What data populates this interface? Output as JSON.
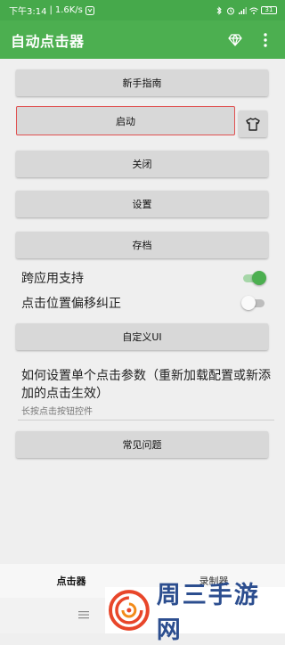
{
  "status_bar": {
    "time": "下午3:14",
    "speed": "1.6K/s",
    "battery": "31"
  },
  "app_bar": {
    "title": "自动点击器",
    "icons": [
      "diamond-icon",
      "more-vert-icon"
    ]
  },
  "buttons": {
    "guide": "新手指南",
    "start": "启动",
    "close": "关闭",
    "settings": "设置",
    "archive": "存档",
    "custom_ui": "自定义UI",
    "faq": "常见问题"
  },
  "toggles": [
    {
      "label": "跨应用支持",
      "on": true
    },
    {
      "label": "点击位置偏移纠正",
      "on": false
    }
  ],
  "info": {
    "title": "如何设置单个点击参数（重新加载配置或新添加的点击生效）",
    "subtitle": "长按点击按钮控件"
  },
  "tabs": [
    {
      "label": "点击器",
      "active": true
    },
    {
      "label": "录制器",
      "active": false
    }
  ],
  "watermark": {
    "text": "周三手游网"
  },
  "colors": {
    "primary": "#4caf50",
    "status_bar": "#46a94b",
    "highlight_border": "#e05050",
    "button_bg": "#d8d8d8",
    "page_bg": "#efefef"
  }
}
